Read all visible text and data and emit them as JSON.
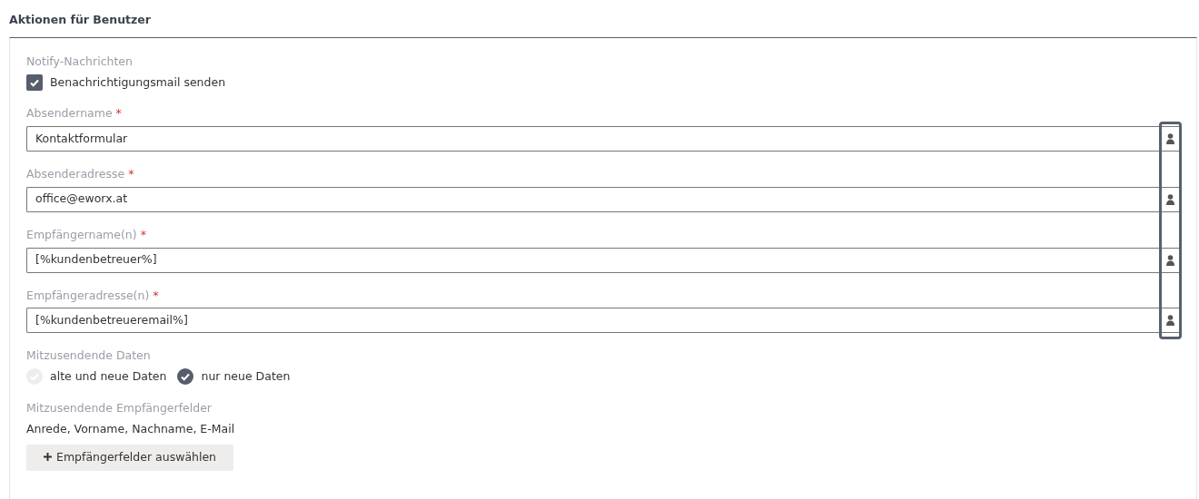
{
  "heading": "Aktionen für Benutzer",
  "notify": {
    "label": "Notify-Nachrichten",
    "option": {
      "label": "Benachrichtigungsmail senden",
      "checked": true
    }
  },
  "fields": [
    {
      "label": "Absendername",
      "required_mark": "*",
      "value": "Kontaktformular"
    },
    {
      "label": "Absenderadresse",
      "required_mark": "*",
      "value": "office@eworx.at"
    },
    {
      "label": "Empfängername(n)",
      "required_mark": "*",
      "value": "[%kundenbetreuer%]"
    },
    {
      "label": "Empfängeradresse(n)",
      "required_mark": "*",
      "value": "[%kundenbetreueremail%]"
    }
  ],
  "data_to_send": {
    "label": "Mitzusendende Daten",
    "options": [
      {
        "label": "alte und neue Daten",
        "selected": false
      },
      {
        "label": "nur neue Daten",
        "selected": true
      }
    ]
  },
  "recipient_fields": {
    "label": "Mitzusendende Empfängerfelder",
    "value": "Anrede, Vorname, Nachname, E-Mail",
    "button": "Empfängerfelder auswählen"
  }
}
